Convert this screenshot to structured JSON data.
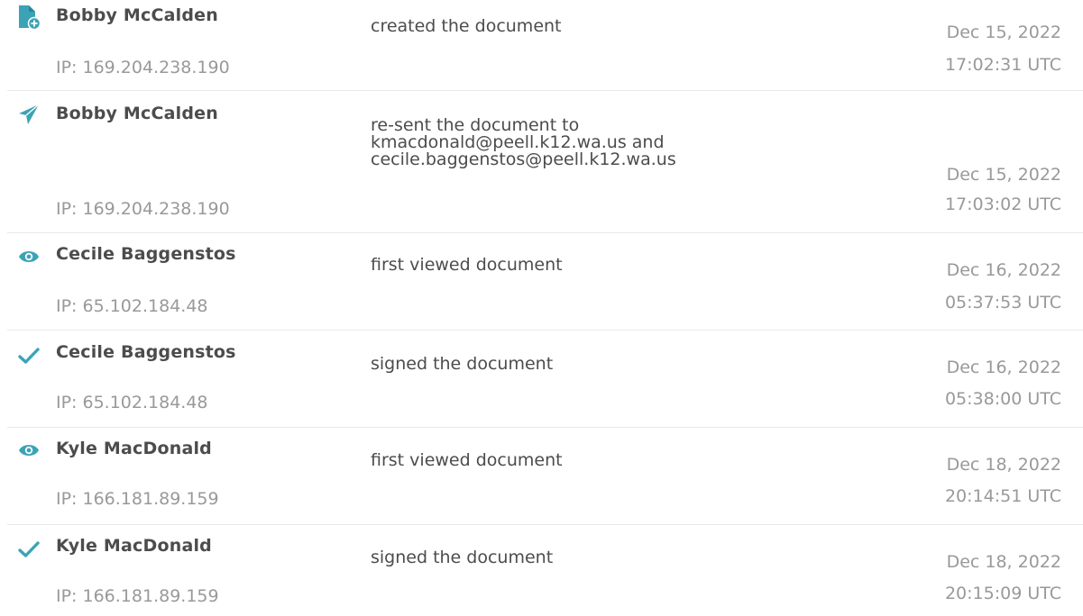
{
  "entries": [
    {
      "icon": "document-plus-icon",
      "name": "Bobby McCalden",
      "ip": "IP: 169.204.238.190",
      "action": "created the document",
      "date": "Dec 15, 2022",
      "time": "17:02:31 UTC"
    },
    {
      "icon": "paper-plane-icon",
      "name": "Bobby McCalden",
      "ip": "IP: 169.204.238.190",
      "action": "re-sent the document to kmacdonald@peell.k12.wa.us and cecile.baggenstos@peell.k12.wa.us",
      "date": "Dec 15, 2022",
      "time": "17:03:02 UTC"
    },
    {
      "icon": "eye-icon",
      "name": "Cecile Baggenstos",
      "ip": "IP: 65.102.184.48",
      "action": "first viewed document",
      "date": "Dec 16, 2022",
      "time": "05:37:53 UTC"
    },
    {
      "icon": "checkmark-icon",
      "name": "Cecile Baggenstos",
      "ip": "IP: 65.102.184.48",
      "action": "signed the document",
      "date": "Dec 16, 2022",
      "time": "05:38:00 UTC"
    },
    {
      "icon": "eye-icon",
      "name": "Kyle MacDonald",
      "ip": "IP: 166.181.89.159",
      "action": "first viewed document",
      "date": "Dec 18, 2022",
      "time": "20:14:51 UTC"
    },
    {
      "icon": "checkmark-icon",
      "name": "Kyle MacDonald",
      "ip": "IP: 166.181.89.159",
      "action": "signed the document",
      "date": "Dec 18, 2022",
      "time": "20:15:09 UTC"
    }
  ],
  "colors": {
    "icon": "#3ca3b6",
    "name": "#4c4c4c",
    "muted": "#999999",
    "divider": "#e8e8e8"
  }
}
